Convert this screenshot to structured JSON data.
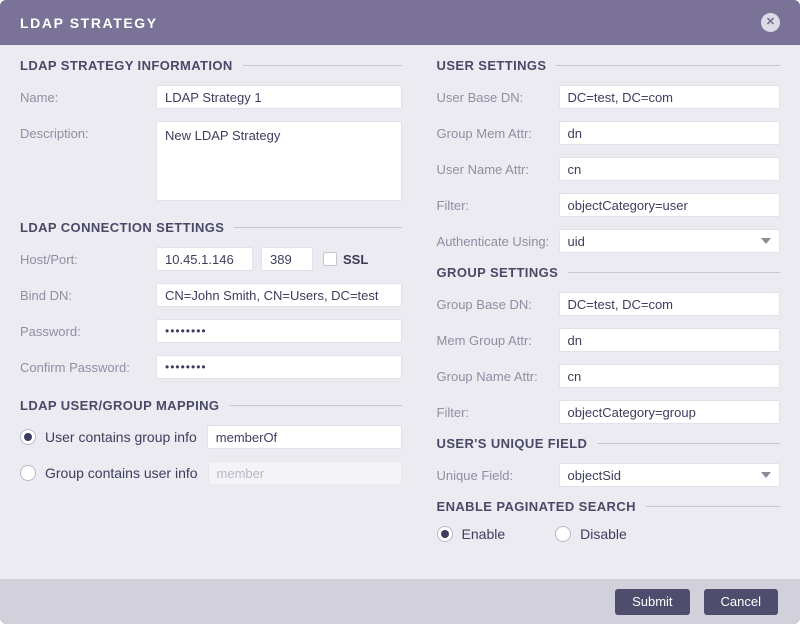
{
  "dialog": {
    "title": "LDAP STRATEGY",
    "close_icon": "✕"
  },
  "sections": {
    "info": {
      "title": "LDAP STRATEGY INFORMATION",
      "name": {
        "label": "Name:",
        "value": "LDAP Strategy 1"
      },
      "description": {
        "label": "Description:",
        "value": "New LDAP Strategy"
      }
    },
    "connection": {
      "title": "LDAP CONNECTION SETTINGS",
      "host_port": {
        "label": "Host/Port:",
        "host": "10.45.1.146",
        "port": "389",
        "ssl_label": "SSL",
        "ssl_checked": false
      },
      "bind_dn": {
        "label": "Bind DN:",
        "value": "CN=John Smith, CN=Users, DC=test"
      },
      "password": {
        "label": "Password:",
        "value": "••••••••"
      },
      "confirm_password": {
        "label": "Confirm Password:",
        "value": "••••••••"
      }
    },
    "mapping": {
      "title": "LDAP USER/GROUP MAPPING",
      "user_contains": {
        "label": "User contains group info",
        "selected": true,
        "value": "memberOf"
      },
      "group_contains": {
        "label": "Group contains user info",
        "selected": false,
        "placeholder": "member"
      }
    },
    "user_settings": {
      "title": "USER SETTINGS",
      "user_base_dn": {
        "label": "User Base DN:",
        "value": "DC=test, DC=com"
      },
      "group_mem_attr": {
        "label": "Group Mem Attr:",
        "value": "dn"
      },
      "user_name_attr": {
        "label": "User Name Attr:",
        "value": "cn"
      },
      "filter": {
        "label": "Filter:",
        "value": "objectCategory=user"
      },
      "authenticate_using": {
        "label": "Authenticate Using:",
        "value": "uid"
      }
    },
    "group_settings": {
      "title": "GROUP SETTINGS",
      "group_base_dn": {
        "label": "Group Base DN:",
        "value": "DC=test, DC=com"
      },
      "mem_group_attr": {
        "label": "Mem Group Attr:",
        "value": "dn"
      },
      "group_name_attr": {
        "label": "Group Name Attr:",
        "value": "cn"
      },
      "filter": {
        "label": "Filter:",
        "value": "objectCategory=group"
      }
    },
    "unique_field": {
      "title": "USER'S UNIQUE FIELD",
      "field": {
        "label": "Unique Field:",
        "value": "objectSid"
      }
    },
    "paginated_search": {
      "title": "ENABLE PAGINATED SEARCH",
      "enable": {
        "label": "Enable",
        "selected": true
      },
      "disable": {
        "label": "Disable",
        "selected": false
      }
    }
  },
  "footer": {
    "submit_label": "Submit",
    "cancel_label": "Cancel"
  },
  "colors": {
    "header_bg": "#7a7397",
    "body_bg": "#ecebf1",
    "footer_bg": "#d1d0db",
    "section_title": "#4a4a68",
    "label": "#8f8ea4",
    "value_text": "#3d3d5e",
    "button_bg": "#4e4d6e"
  }
}
